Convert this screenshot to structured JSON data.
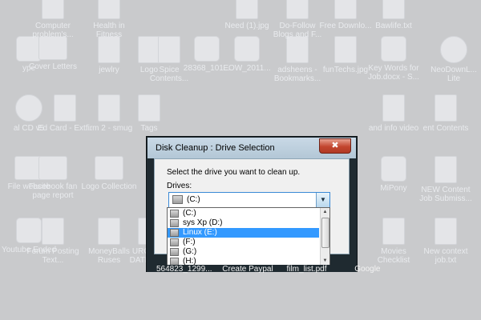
{
  "desktop": {
    "icons": [
      {
        "label": "ype",
        "glyph": "app"
      },
      {
        "label": "Cover Letters",
        "glyph": "folder"
      },
      {
        "label": "jewlry",
        "glyph": "file"
      },
      {
        "label": "Logo",
        "glyph": "file"
      },
      {
        "label": "Spice Contents...",
        "glyph": "file"
      },
      {
        "label": "28368_101...",
        "glyph": "app"
      },
      {
        "label": "EOW_2011...",
        "glyph": "app"
      },
      {
        "label": "adsheens - Bookmarks...",
        "glyph": "file"
      },
      {
        "label": "funTechs.jpg",
        "glyph": "file"
      },
      {
        "label": "Key Words for Job.docx - S...",
        "glyph": "app"
      },
      {
        "label": "NeoDownL... Lite",
        "glyph": "round"
      },
      {
        "label": "al CD v5",
        "glyph": "round"
      },
      {
        "label": "Ed Card - Ext...",
        "glyph": "file"
      },
      {
        "label": "firm 2 - smug",
        "glyph": "file"
      },
      {
        "label": "Tags",
        "glyph": "file"
      },
      {
        "label": "and info video",
        "glyph": "file"
      },
      {
        "label": "ent Contents",
        "glyph": "file"
      },
      {
        "label": "File website",
        "glyph": "folder"
      },
      {
        "label": "Facebook fan page report",
        "glyph": "folder"
      },
      {
        "label": "Logo Collection",
        "glyph": "folder"
      },
      {
        "label": "MiPony",
        "glyph": "app"
      },
      {
        "label": "NEW Content Job Submiss...",
        "glyph": "file"
      },
      {
        "label": "Youtube Ended",
        "glyph": "app"
      },
      {
        "label": "Forum Posting Text...",
        "glyph": "file"
      },
      {
        "label": "MoneyBalls Ruses",
        "glyph": "file"
      },
      {
        "label": "URGENT DATEWEB",
        "glyph": "file"
      },
      {
        "label": "Movies Checklist",
        "glyph": "file"
      },
      {
        "label": "New context job.txt",
        "glyph": "file"
      },
      {
        "label": "Computer problem's...",
        "glyph": "file"
      },
      {
        "label": "Health in Fitness",
        "glyph": "file"
      },
      {
        "label": "Need (1).jpg",
        "glyph": "file"
      },
      {
        "label": "Do-Follow Blogs and F...",
        "glyph": "file"
      },
      {
        "label": "Free Downlo...",
        "glyph": "file"
      },
      {
        "label": "Bawlife.txt",
        "glyph": "file"
      }
    ]
  },
  "dialog": {
    "title": "Disk Cleanup : Drive Selection",
    "close_icon": "✖",
    "prompt": "Select the drive you want to clean up.",
    "drives_label": "Drives:",
    "selected_drive": "(C:)",
    "dropdown_arrow": "▼",
    "drive_options": [
      {
        "label": "(C:)",
        "selected": false
      },
      {
        "label": "sys Xp (D:)",
        "selected": false
      },
      {
        "label": "Linux (E:)",
        "selected": true
      },
      {
        "label": "(F:)",
        "selected": false
      },
      {
        "label": "(G:)",
        "selected": false
      },
      {
        "label": "(H:)",
        "selected": false
      }
    ],
    "scroll_up": "▲",
    "scroll_down": "▼"
  },
  "taskbar_labels": {
    "a": "564823_1299...",
    "b": "Create Paypal",
    "c": "film_list.pdf",
    "d": "Google"
  },
  "colors": {
    "desktop_bg": "#c9cacc",
    "selection": "#3399ff",
    "dialog_frame": "#1f2a30",
    "close_button": "#c2452e"
  }
}
